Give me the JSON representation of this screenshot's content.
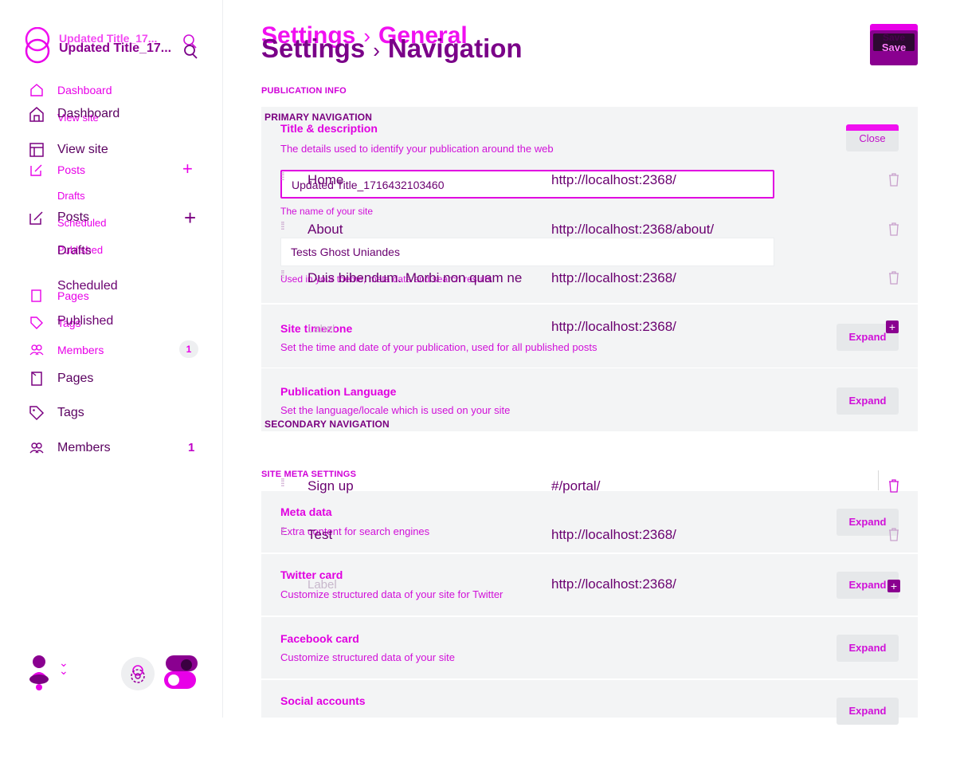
{
  "sidebar": {
    "site_title_ghost": "Updated Title_17...",
    "site_title": "Updated Title_17...",
    "nav_ghost": {
      "dashboard": "Dashboard",
      "view_site": "View site",
      "posts": "Posts",
      "drafts": "Drafts",
      "scheduled": "Scheduled",
      "published": "Published",
      "pages": "Pages",
      "tags": "Tags",
      "members": "Members",
      "members_count": "1"
    },
    "nav": {
      "dashboard": "Dashboard",
      "view_site": "View site",
      "posts": "Posts",
      "drafts": "Drafts",
      "scheduled": "Scheduled",
      "published": "Published",
      "pages": "Pages",
      "tags": "Tags",
      "members": "Members",
      "members_count": "1"
    }
  },
  "header": {
    "breadcrumb_ghost": {
      "root": "Settings",
      "current": "General"
    },
    "breadcrumb": {
      "root": "Settings",
      "current": "Navigation"
    },
    "save_ghost": "Save",
    "save": "Save"
  },
  "general": {
    "publication_info": "PUBLICATION INFO",
    "title_card": {
      "title": "Title & description",
      "desc": "The details used to identify your publication around the web",
      "close": "Close",
      "title_value": "Updated Title_1716432103460",
      "title_hint": "The name of your site",
      "description_value": "Tests Ghost Uniandes",
      "description_hint": "Used in your theme, meta data and search results"
    },
    "timezone": {
      "title": "Site timezone",
      "desc": "Set the time and date of your publication, used for all published posts",
      "expand": "Expand"
    },
    "language": {
      "title": "Publication Language",
      "desc": "Set the language/locale which is used on your site",
      "expand": "Expand"
    },
    "site_meta": "SITE META SETTINGS",
    "meta_data": {
      "title": "Meta data",
      "desc": "Extra content for search engines",
      "expand": "Expand"
    },
    "twitter": {
      "title": "Twitter card",
      "desc": "Customize structured data of your site for Twitter",
      "expand": "Expand"
    },
    "facebook": {
      "title": "Facebook card",
      "desc": "Customize structured data of your site",
      "expand": "Expand"
    },
    "social": {
      "title": "Social accounts",
      "expand": "Expand"
    }
  },
  "navigation": {
    "primary_label": "PRIMARY NAVIGATION",
    "primary": [
      {
        "label": "Home",
        "url": "http://localhost:2368/"
      },
      {
        "label": "About",
        "url": "http://localhost:2368/about/"
      },
      {
        "label": "Duis bibendum. Morbi non quam nec d",
        "url": "http://localhost:2368/"
      }
    ],
    "primary_new": {
      "label": "Label",
      "url": "http://localhost:2368/"
    },
    "secondary_label": "SECONDARY NAVIGATION",
    "secondary": [
      {
        "label": "Sign up",
        "url": "#/portal/"
      },
      {
        "label": "Test",
        "url": "http://localhost:2368/"
      }
    ],
    "secondary_new": {
      "label": "Label",
      "url": "http://localhost:2368/"
    }
  },
  "colors": {
    "accent": "#e800e8",
    "dark_accent": "#7a0088",
    "panel": "#f3f4f5"
  }
}
